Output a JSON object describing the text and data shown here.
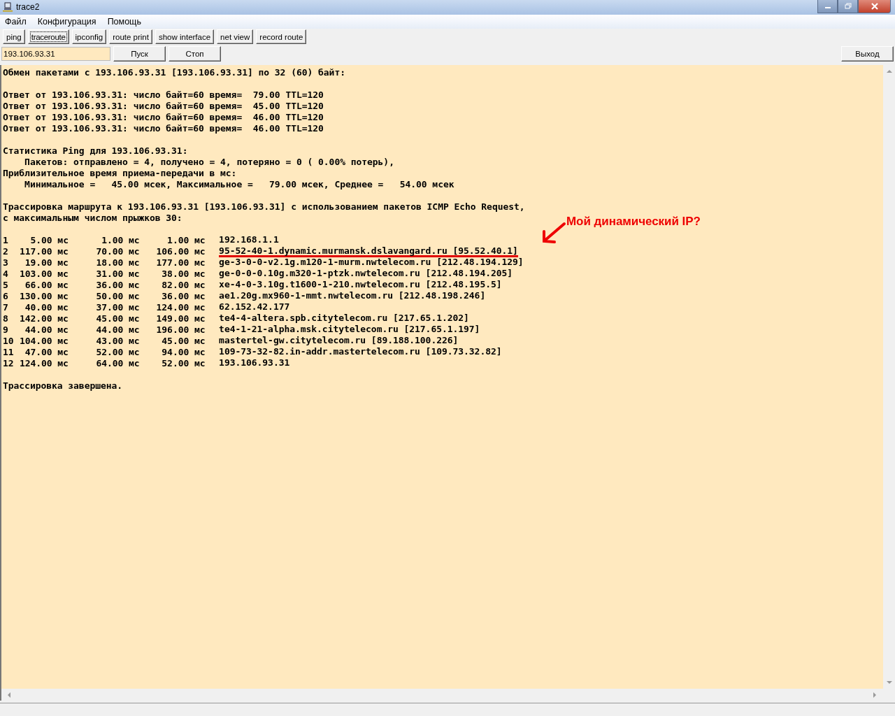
{
  "window": {
    "title": "trace2"
  },
  "menu": [
    "Файл",
    "Конфигурация",
    "Помощь"
  ],
  "tools": [
    {
      "label": "ping",
      "selected": false
    },
    {
      "label": "traceroute",
      "selected": true
    },
    {
      "label": "ipconfig",
      "selected": false
    },
    {
      "label": "route print",
      "selected": false
    },
    {
      "label": "show interface",
      "selected": false
    },
    {
      "label": "net view",
      "selected": false
    },
    {
      "label": "record route",
      "selected": false
    }
  ],
  "host_field": {
    "value": "193.106.93.31"
  },
  "start_button": "Пуск",
  "stop_button": "Стоп",
  "exit_button": "Выход",
  "output": [
    {
      "kind": "text",
      "lines": [
        "Обмен пакетами с 193.106.93.31 [193.106.93.31] по 32 (60) байт:"
      ]
    },
    {
      "kind": "text",
      "lines": [
        "Ответ от 193.106.93.31: число байт=60 время=  79.00 TTL=120",
        "Ответ от 193.106.93.31: число байт=60 время=  45.00 TTL=120",
        "Ответ от 193.106.93.31: число байт=60 время=  46.00 TTL=120",
        "Ответ от 193.106.93.31: число байт=60 время=  46.00 TTL=120"
      ]
    },
    {
      "kind": "text",
      "lines": [
        "Статистика Ping для 193.106.93.31:",
        "    Пакетов: отправлено = 4, получено = 4, потеряно = 0 ( 0.00% потерь),",
        "Приблизительное время приема-передачи в мс:",
        "    Минимальное =   45.00 мсек, Максимальное =   79.00 мсек, Среднее =   54.00 мсек"
      ]
    },
    {
      "kind": "text",
      "lines": [
        "Трассировка маршрута к 193.106.93.31 [193.106.93.31] с использованием пакетов ICMP Echo Request,",
        "с максимальным числом прыжков 30:"
      ]
    },
    {
      "kind": "hops",
      "hops": [
        {
          "hop": "1",
          "rtt": [
            "5.00 мс",
            "1.00 мс",
            "1.00 мс"
          ],
          "host": "192.168.1.1",
          "underlined": false
        },
        {
          "hop": "2",
          "rtt": [
            "117.00 мс",
            "70.00 мс",
            "106.00 мс"
          ],
          "host": "95-52-40-1.dynamic.murmansk.dslavangard.ru [95.52.40.1]",
          "underlined": true
        },
        {
          "hop": "3",
          "rtt": [
            "19.00 мс",
            "18.00 мс",
            "177.00 мс"
          ],
          "host": "ge-3-0-0-v2.1g.m120-1-murm.nwtelecom.ru [212.48.194.129]",
          "underlined": false
        },
        {
          "hop": "4",
          "rtt": [
            "103.00 мс",
            "31.00 мс",
            "38.00 мс"
          ],
          "host": "ge-0-0-0.10g.m320-1-ptzk.nwtelecom.ru [212.48.194.205]",
          "underlined": false
        },
        {
          "hop": "5",
          "rtt": [
            "66.00 мс",
            "36.00 мс",
            "82.00 мс"
          ],
          "host": "xe-4-0-3.10g.t1600-1-210.nwtelecom.ru [212.48.195.5]",
          "underlined": false
        },
        {
          "hop": "6",
          "rtt": [
            "130.00 мс",
            "50.00 мс",
            "36.00 мс"
          ],
          "host": "ae1.20g.mx960-1-mmt.nwtelecom.ru [212.48.198.246]",
          "underlined": false
        },
        {
          "hop": "7",
          "rtt": [
            "40.00 мс",
            "37.00 мс",
            "124.00 мс"
          ],
          "host": "62.152.42.177",
          "underlined": false
        },
        {
          "hop": "8",
          "rtt": [
            "142.00 мс",
            "45.00 мс",
            "149.00 мс"
          ],
          "host": "te4-4-altera.spb.citytelecom.ru [217.65.1.202]",
          "underlined": false
        },
        {
          "hop": "9",
          "rtt": [
            "44.00 мс",
            "44.00 мс",
            "196.00 мс"
          ],
          "host": "te4-1-21-alpha.msk.citytelecom.ru [217.65.1.197]",
          "underlined": false
        },
        {
          "hop": "10",
          "rtt": [
            "104.00 мс",
            "43.00 мс",
            "45.00 мс"
          ],
          "host": "mastertel-gw.citytelecom.ru [89.188.100.226]",
          "underlined": false
        },
        {
          "hop": "11",
          "rtt": [
            "47.00 мс",
            "52.00 мс",
            "94.00 мс"
          ],
          "host": "109-73-32-82.in-addr.mastertelecom.ru [109.73.32.82]",
          "underlined": false
        },
        {
          "hop": "12",
          "rtt": [
            "124.00 мс",
            "64.00 мс",
            "52.00 мс"
          ],
          "host": "193.106.93.31",
          "underlined": false
        }
      ]
    },
    {
      "kind": "text",
      "lines": [
        "Трассировка завершена."
      ]
    }
  ],
  "annotation": {
    "text": "Мой динамический IP?"
  }
}
